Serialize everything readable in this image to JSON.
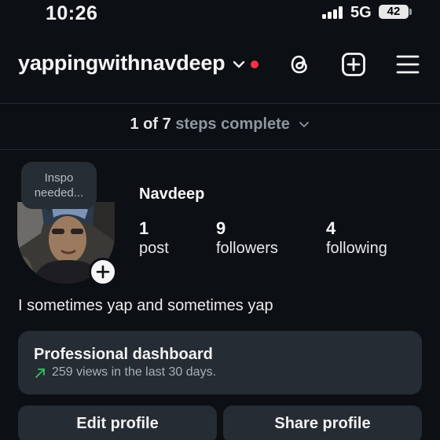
{
  "status_bar": {
    "time": "10:26",
    "network": "5G",
    "battery": "42"
  },
  "header": {
    "username": "yappingwithnavdeep",
    "icons": [
      "chevron-down-icon",
      "threads-icon",
      "create-icon",
      "menu-icon"
    ],
    "notification_dot_color": "#ff3040"
  },
  "steps": {
    "count": "1 of 7",
    "text": "steps complete"
  },
  "profile": {
    "note": [
      "Inspo",
      "needed..."
    ],
    "display_name": "Navdeep",
    "stats": [
      {
        "value": "1",
        "label": "post"
      },
      {
        "value": "9",
        "label": "followers"
      },
      {
        "value": "4",
        "label": "following"
      }
    ],
    "bio": "I sometimes yap and sometimes yap"
  },
  "dashboard": {
    "title": "Professional dashboard",
    "subtitle": "259 views in the last 30 days.",
    "trend_color": "#35c45f"
  },
  "buttons": {
    "edit": "Edit profile",
    "share": "Share profile"
  },
  "colors": {
    "background": "#0c1014",
    "surface": "#262c34"
  }
}
